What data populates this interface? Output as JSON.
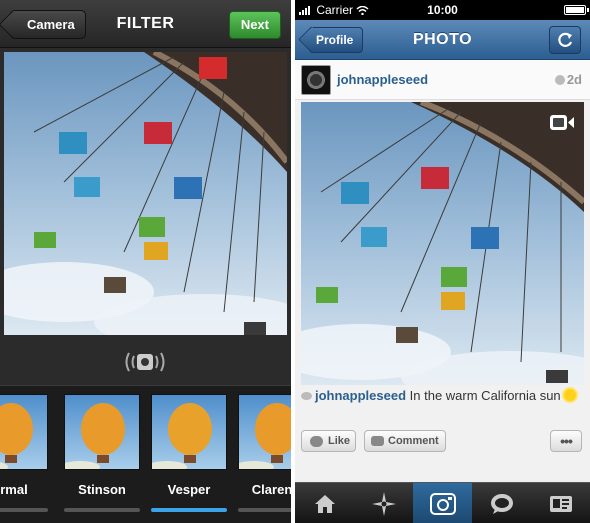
{
  "filter_screen": {
    "back_label": "Camera",
    "title": "FILTER",
    "next_label": "Next",
    "filters": [
      {
        "label": "ormal",
        "active": false
      },
      {
        "label": "Stinson",
        "active": false
      },
      {
        "label": "Vesper",
        "active": true
      },
      {
        "label": "Clarend",
        "active": false
      }
    ]
  },
  "photo_screen": {
    "status": {
      "carrier": "Carrier",
      "time": "10:00"
    },
    "back_label": "Profile",
    "title": "PHOTO",
    "post": {
      "username": "johnappleseed",
      "age": "2d",
      "caption_user": "johnappleseed",
      "caption_text": "In the warm California sun"
    },
    "actions": {
      "like_label": "Like",
      "comment_label": "Comment",
      "more_label": "•••"
    },
    "tabs": [
      "home-icon",
      "explore-icon",
      "camera-icon",
      "news-icon",
      "profile-icon"
    ]
  },
  "colors": {
    "accent_blue": "#2c5e92",
    "next_green": "#3aa138",
    "active_filter": "#3ba4e8"
  }
}
